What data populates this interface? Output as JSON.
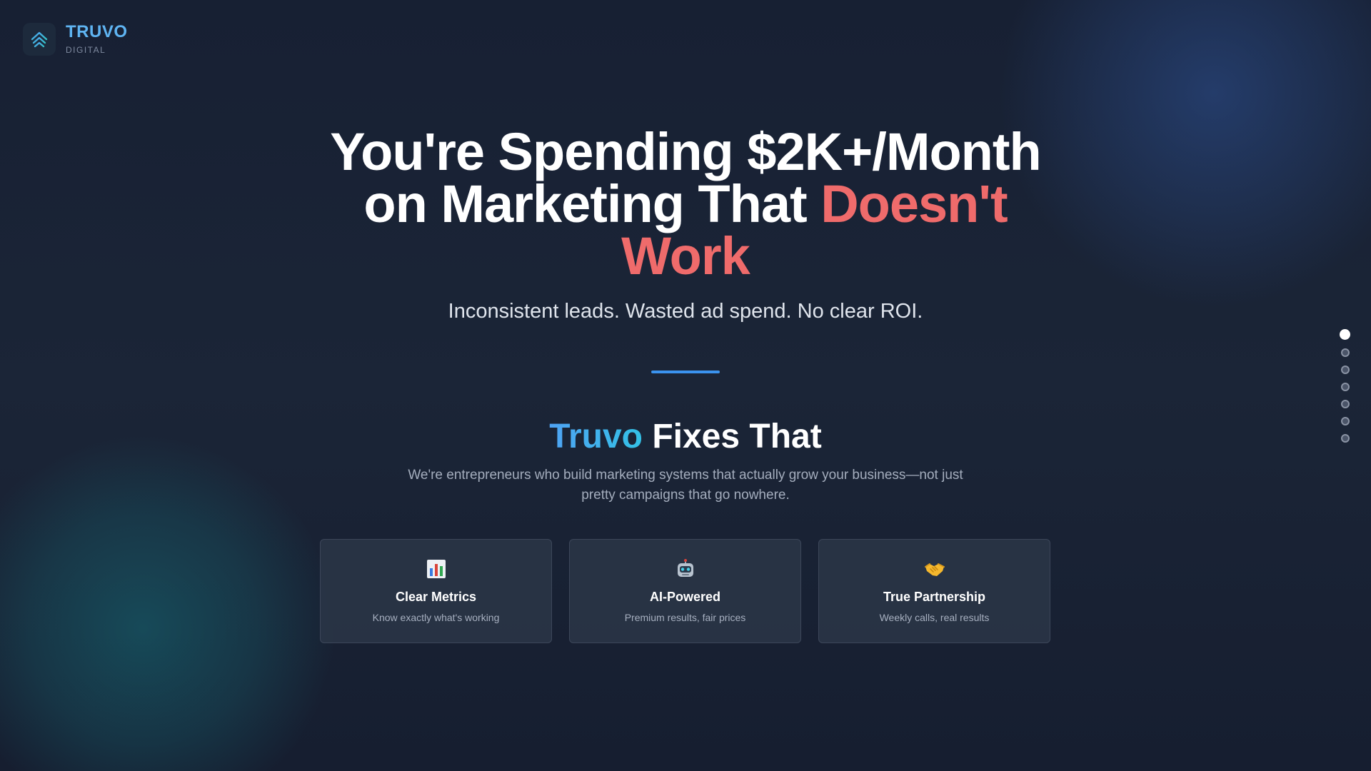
{
  "brand": {
    "name": "TRUVO",
    "tagline": "DIGITAL",
    "icon": "chevrons-up-icon",
    "accent_color": "#5fb4f2"
  },
  "hero": {
    "headline_part1": "You're Spending $2K+/Month on Marketing That",
    "headline_accent": "Doesn't Work",
    "accent_color": "#ef6b6b",
    "subheadline": "Inconsistent leads. Wasted ad spend. No clear ROI."
  },
  "solution": {
    "title_brand": "Truvo",
    "title_rest": "Fixes That",
    "description": "We're entrepreneurs who build marketing systems that actually grow your business—not just pretty campaigns that go nowhere."
  },
  "features": [
    {
      "icon": "bar-chart-icon",
      "title": "Clear Metrics",
      "text": "Know exactly what's working"
    },
    {
      "icon": "robot-icon",
      "title": "AI-Powered",
      "text": "Premium results, fair prices"
    },
    {
      "icon": "handshake-icon",
      "title": "True Partnership",
      "text": "Weekly calls, real results"
    }
  ],
  "navigation": {
    "slide_count": 7,
    "active_slide": 1
  }
}
